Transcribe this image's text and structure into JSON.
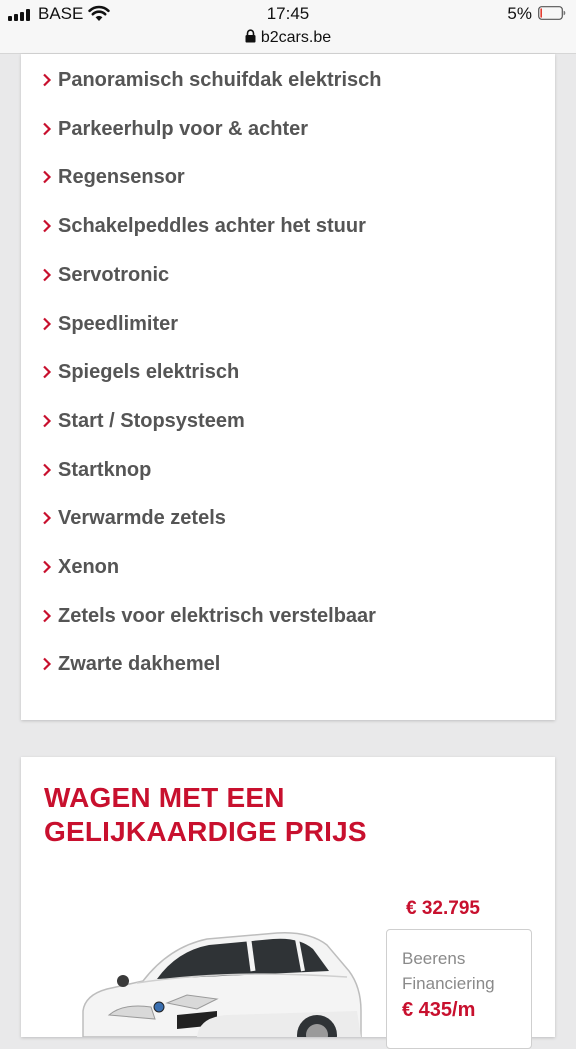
{
  "status_bar": {
    "carrier": "BASE",
    "time": "17:45",
    "domain": "b2cars.be",
    "battery_percent": "5%"
  },
  "features": [
    {
      "label": "Panoramisch schuifdak elektrisch",
      "icon": "chevron-right-icon"
    },
    {
      "label": "Parkeerhulp voor & achter",
      "icon": "chevron-right-icon"
    },
    {
      "label": "Regensensor",
      "icon": "chevron-right-icon"
    },
    {
      "label": "Schakelpeddles achter het stuur",
      "icon": "chevron-right-icon"
    },
    {
      "label": "Servotronic",
      "icon": "chevron-right-icon"
    },
    {
      "label": "Speedlimiter",
      "icon": "chevron-right-icon"
    },
    {
      "label": "Spiegels elektrisch",
      "icon": "chevron-right-icon"
    },
    {
      "label": "Start / Stopsysteem",
      "icon": "chevron-right-icon"
    },
    {
      "label": "Startknop",
      "icon": "chevron-right-icon"
    },
    {
      "label": "Verwarmde zetels",
      "icon": "chevron-right-icon"
    },
    {
      "label": "Xenon",
      "icon": "chevron-right-icon"
    },
    {
      "label": "Zetels voor elektrisch verstelbaar",
      "icon": "chevron-right-icon"
    },
    {
      "label": "Zwarte dakhemel",
      "icon": "chevron-right-icon"
    }
  ],
  "similar_price": {
    "title_line1": "WAGEN MET EEN",
    "title_line2": "GELIJKAARDIGE PRIJS",
    "price": "€ 32.795",
    "financing_label": "Beerens Financiering",
    "financing_amount": "€ 435/m"
  },
  "colors": {
    "accent": "#c8102e",
    "feature_text": "#555555",
    "background": "#e9e9ea"
  }
}
